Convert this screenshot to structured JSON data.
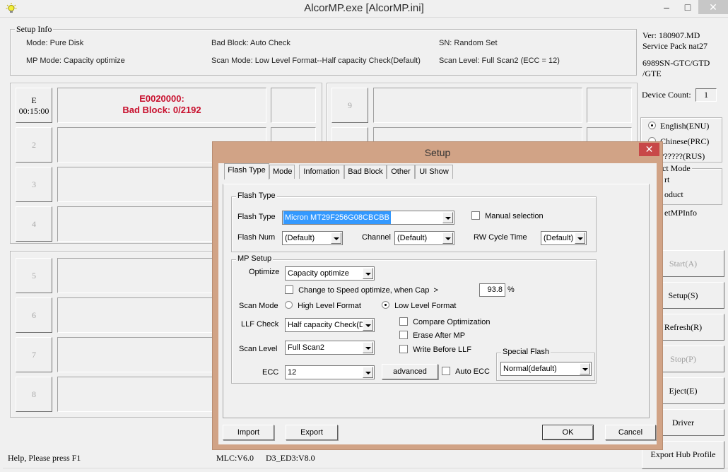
{
  "window": {
    "title": "AlcorMP.exe [AlcorMP.ini]",
    "min_glyph": "–",
    "max_glyph": "□",
    "close_glyph": "✕"
  },
  "setup_info": {
    "label": "Setup Info",
    "mode": "Mode: Pure Disk",
    "bad_block": "Bad Block: Auto Check",
    "sn": "SN: Random Set",
    "mp_mode": "MP Mode: Capacity optimize",
    "scan_mode": "Scan Mode: Low Level Format--Half capacity Check(Default)",
    "scan_level": "Scan Level: Full Scan2 (ECC = 12)"
  },
  "version": {
    "ver": "Ver: 180907.MD",
    "service_pack": "Service Pack nat27",
    "chip_line1": "6989SN-GTC/GTD",
    "chip_line2": "/GTE",
    "device_count_label": "Device Count:",
    "device_count_value": "1"
  },
  "slots": [
    {
      "id": "E",
      "time": "00:15:00",
      "message_line1": "E0020000:",
      "message_line2": "Bad Block: 0/2192",
      "active": true
    },
    {
      "id": "2"
    },
    {
      "id": "3"
    },
    {
      "id": "4"
    },
    {
      "id": "5"
    },
    {
      "id": "6"
    },
    {
      "id": "7"
    },
    {
      "id": "8"
    },
    {
      "id": "9"
    }
  ],
  "language": {
    "options": [
      "English(ENU)",
      "Chinese(PRC)",
      "??????(RUS)"
    ],
    "selected": "English(ENU)"
  },
  "select_mode": {
    "label_partial": "ct Mode",
    "option1_partial": "rt",
    "option2_partial": "oduct",
    "getmpinfo_partial": "etMPInfo"
  },
  "side_buttons": {
    "start": "Start(A)",
    "setup": "Setup(S)",
    "refresh": "Refresh(R)",
    "stop": "Stop(P)",
    "eject": "Eject(E)",
    "driver": "Driver",
    "export_hub_profile": "Export Hub Profile"
  },
  "status_bar": {
    "help": "Help, Please press F1",
    "mlc": "MLC:V6.0",
    "d3": "D3_ED3:V8.0"
  },
  "dialog": {
    "title": "Setup",
    "close_glyph": "✕",
    "tabs": [
      "Flash Type",
      "Mode",
      "Infomation",
      "Bad Block",
      "Other",
      "UI Show"
    ],
    "active_tab": "Flash Type",
    "flash_type_group": {
      "label": "Flash Type",
      "flash_type_label": "Flash Type",
      "flash_type_value": "Micron MT29F256G08CBCBB",
      "manual_selection_label": "Manual selection",
      "manual_selection_checked": false,
      "flash_num_label": "Flash Num",
      "flash_num_value": "(Default)",
      "channel_label": "Channel",
      "channel_value": "(Default)",
      "rw_cycle_label": "RW Cycle Time",
      "rw_cycle_value": "(Default)"
    },
    "mp_setup": {
      "label": "MP Setup",
      "optimize_label": "Optimize",
      "optimize_value": "Capacity optimize",
      "change_speed_label": "Change to Speed optimize, when Cap  >",
      "change_speed_checked": false,
      "cap_value": "93.8",
      "cap_unit": "%",
      "scan_mode_label": "Scan Mode",
      "scan_mode_options": [
        "High Level Format",
        "Low Level Format"
      ],
      "scan_mode_selected": "Low Level Format",
      "llf_check_label": "LLF Check",
      "llf_check_value": "Half capacity Check(D",
      "compare_optimization_label": "Compare Optimization",
      "erase_after_mp_label": "Erase After MP",
      "write_before_llf_label": "Write Before LLF",
      "scan_level_label": "Scan Level",
      "scan_level_value": "Full Scan2",
      "ecc_label": "ECC",
      "ecc_value": "12",
      "advanced_label": "advanced",
      "auto_ecc_label": "Auto ECC",
      "special_flash_label": "Special Flash",
      "special_flash_value": "Normal(default)"
    },
    "buttons": {
      "import": "Import",
      "export": "Export",
      "ok": "OK",
      "cancel": "Cancel"
    }
  }
}
